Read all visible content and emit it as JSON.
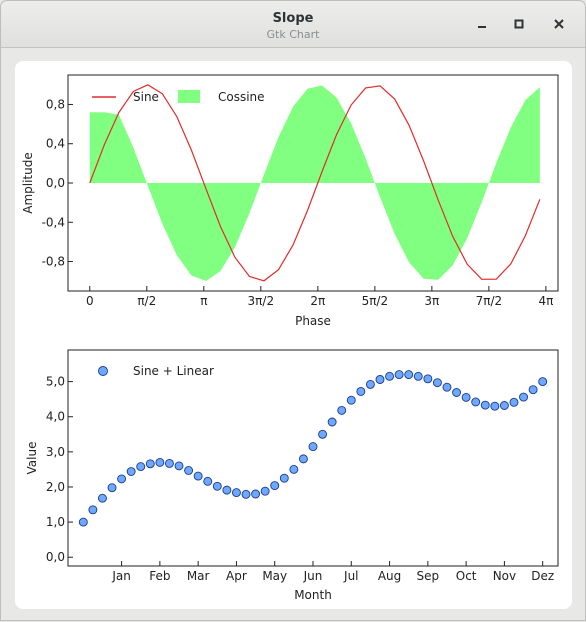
{
  "window": {
    "title": "Slope",
    "subtitle": "Gtk Chart",
    "minimize_icon": "minimize-icon",
    "maximize_icon": "maximize-icon",
    "close_icon": "close-icon"
  },
  "chart_data": [
    {
      "type": "line",
      "xlabel": "Phase",
      "ylabel": "Amplitude",
      "xlim": [
        -0.6,
        12.9
      ],
      "ylim": [
        -1.1,
        1.1
      ],
      "xticks": [
        {
          "value": 0,
          "label": "0"
        },
        {
          "value": 1.5708,
          "label": "π/2"
        },
        {
          "value": 3.1416,
          "label": "π"
        },
        {
          "value": 4.7124,
          "label": "3π/2"
        },
        {
          "value": 6.2832,
          "label": "2π"
        },
        {
          "value": 7.854,
          "label": "5π/2"
        },
        {
          "value": 9.4248,
          "label": "3π"
        },
        {
          "value": 10.9956,
          "label": "7π/2"
        },
        {
          "value": 12.5664,
          "label": "4π"
        }
      ],
      "yticks": [
        {
          "value": 0.8,
          "label": "0,8"
        },
        {
          "value": 0.4,
          "label": "0,4"
        },
        {
          "value": 0.0,
          "label": "0,0"
        },
        {
          "value": -0.4,
          "label": "-0,4"
        },
        {
          "value": -0.8,
          "label": "-0,8"
        }
      ],
      "legend_placement": "top-left",
      "series": [
        {
          "name": "Sine",
          "style": "line",
          "color": "#e32b2b",
          "x": [
            0,
            0.4,
            0.8,
            1.2,
            1.6,
            2.0,
            2.4,
            2.8,
            3.2,
            3.6,
            4.0,
            4.4,
            4.8,
            5.2,
            5.6,
            6.0,
            6.4,
            6.8,
            7.2,
            7.6,
            8.0,
            8.4,
            8.8,
            9.2,
            9.6,
            10.0,
            10.4,
            10.8,
            11.2,
            11.6,
            12.0,
            12.4
          ],
          "y": [
            0.0,
            0.389,
            0.717,
            0.932,
            1.0,
            0.909,
            0.675,
            0.335,
            -0.058,
            -0.443,
            -0.757,
            -0.952,
            -0.996,
            -0.883,
            -0.631,
            -0.279,
            0.117,
            0.494,
            0.794,
            0.968,
            0.989,
            0.855,
            0.585,
            0.223,
            -0.175,
            -0.544,
            -0.828,
            -0.981,
            -0.979,
            -0.824,
            -0.537,
            -0.166
          ]
        },
        {
          "name": "Cossine",
          "style": "area",
          "color": "#80ff80",
          "x": [
            0,
            0.4,
            0.8,
            1.2,
            1.6,
            2.0,
            2.4,
            2.8,
            3.2,
            3.6,
            4.0,
            4.4,
            4.8,
            5.2,
            5.6,
            6.0,
            6.4,
            6.8,
            7.2,
            7.6,
            8.0,
            8.4,
            8.8,
            9.2,
            9.6,
            10.0,
            10.4,
            10.8,
            11.2,
            11.6,
            12.0,
            12.4
          ],
          "y": [
            0.721,
            0.721,
            0.697,
            0.362,
            -0.029,
            -0.416,
            -0.737,
            -0.942,
            -0.998,
            -0.897,
            -0.654,
            -0.307,
            0.087,
            0.468,
            0.776,
            0.96,
            0.993,
            0.869,
            0.608,
            0.251,
            -0.146,
            -0.519,
            -0.811,
            -0.975,
            -0.985,
            -0.839,
            -0.56,
            -0.195,
            0.205,
            0.566,
            0.844,
            0.977
          ]
        }
      ]
    },
    {
      "type": "scatter",
      "xlabel": "Month",
      "ylabel": "Value",
      "ylim": [
        -0.25,
        5.9
      ],
      "xticks": [
        "Jan",
        "Feb",
        "Mar",
        "Apr",
        "May",
        "Jun",
        "Jul",
        "Aug",
        "Sep",
        "Oct",
        "Nov",
        "Dez"
      ],
      "yticks": [
        {
          "value": 5.0,
          "label": "5,0"
        },
        {
          "value": 4.0,
          "label": "4,0"
        },
        {
          "value": 3.0,
          "label": "3,0"
        },
        {
          "value": 2.0,
          "label": "2,0"
        },
        {
          "value": 1.0,
          "label": "1,0"
        },
        {
          "value": 0.0,
          "label": "0,0"
        }
      ],
      "legend_placement": "top-left",
      "series": [
        {
          "name": "Sine + Linear",
          "color": "#6fa8ff",
          "x": [
            0,
            0.25,
            0.5,
            0.75,
            1.0,
            1.25,
            1.5,
            1.75,
            2.0,
            2.25,
            2.5,
            2.75,
            3.0,
            3.25,
            3.5,
            3.75,
            4.0,
            4.25,
            4.5,
            4.75,
            5.0,
            5.25,
            5.5,
            5.75,
            6.0,
            6.25,
            6.5,
            6.75,
            7.0,
            7.25,
            7.5,
            7.75,
            8.0,
            8.25,
            8.5,
            8.75,
            9.0,
            9.25,
            9.5,
            9.75,
            10.0,
            10.25,
            10.5,
            10.75,
            11.0,
            11.25,
            11.5,
            11.75,
            12.0
          ],
          "y": [
            1.0,
            1.35,
            1.68,
            1.98,
            2.23,
            2.44,
            2.58,
            2.66,
            2.7,
            2.67,
            2.6,
            2.47,
            2.31,
            2.16,
            2.02,
            1.91,
            1.84,
            1.79,
            1.8,
            1.88,
            2.04,
            2.25,
            2.5,
            2.8,
            3.15,
            3.5,
            3.85,
            4.18,
            4.47,
            4.72,
            4.92,
            5.06,
            5.15,
            5.2,
            5.2,
            5.15,
            5.08,
            4.97,
            4.84,
            4.69,
            4.55,
            4.42,
            4.33,
            4.3,
            4.32,
            4.41,
            4.56,
            4.77,
            5.0
          ]
        }
      ]
    }
  ]
}
